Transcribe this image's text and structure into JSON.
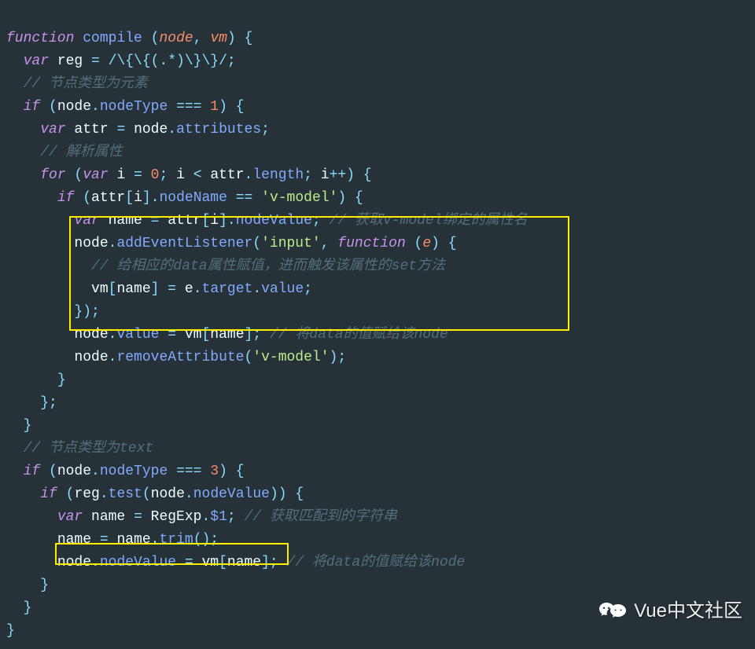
{
  "code": {
    "l1_kw_function": "function",
    "l1_fn": "compile",
    "l1_paren_open": "(",
    "l1_param1": "node",
    "l1_comma": ", ",
    "l1_param2": "vm",
    "l1_paren_close": ")",
    "l1_brace": " {",
    "l2_kw_var": "var",
    "l2_name": " reg ",
    "l2_eq": "=",
    "l2_regex": " /\\{\\{(.*)\\}\\}/",
    "l2_semi": ";",
    "l3_comment": "// 节点类型为元素",
    "l4_kw_if": "if",
    "l4_open": " (",
    "l4_node": "node",
    "l4_dot": ".",
    "l4_prop": "nodeType",
    "l4_eqeq": " === ",
    "l4_num": "1",
    "l4_close": ") {",
    "l5_kw_var": "var",
    "l5_name": " attr ",
    "l5_eq": "=",
    "l5_sp": " ",
    "l5_node": "node",
    "l5_dot": ".",
    "l5_prop": "attributes",
    "l5_semi": ";",
    "l6_comment": "// 解析属性",
    "l7_kw_for": "for",
    "l7_open": " (",
    "l7_kw_var": "var",
    "l7_i": " i ",
    "l7_eq": "=",
    "l7_sp": " ",
    "l7_zero": "0",
    "l7_semi1": "; ",
    "l7_i2": "i ",
    "l7_lt": "<",
    "l7_sp2": " ",
    "l7_attr": "attr",
    "l7_dot": ".",
    "l7_len": "length",
    "l7_semi2": "; ",
    "l7_i3": "i",
    "l7_pp": "++",
    "l7_close": ") {",
    "l8_kw_if": "if",
    "l8_open": " (",
    "l8_attr": "attr",
    "l8_br1": "[",
    "l8_i": "i",
    "l8_br2": "]",
    "l8_dot": ".",
    "l8_nn": "nodeName",
    "l8_eqeq": " == ",
    "l8_str": "'v-model'",
    "l8_close": ") {",
    "l9_kw_var": "var",
    "l9_name": " name ",
    "l9_eq": "=",
    "l9_sp": " ",
    "l9_attr": "attr",
    "l9_br1": "[",
    "l9_i": "i",
    "l9_br2": "]",
    "l9_dot": ".",
    "l9_nv": "nodeValue",
    "l9_semi": "; ",
    "l9_comment": "// 获取v-model绑定的属性名",
    "l10_node": "node",
    "l10_dot": ".",
    "l10_fn": "addEventListener",
    "l10_open": "(",
    "l10_str": "'input'",
    "l10_comma": ", ",
    "l10_kw_fn": "function",
    "l10_po": " (",
    "l10_e": "e",
    "l10_pc": ") {",
    "l11_comment": "// 给相应的data属性赋值，进而触发该属性的set方法",
    "l12_vm": "vm",
    "l12_br1": "[",
    "l12_name": "name",
    "l12_br2": "]",
    "l12_eq": " = ",
    "l12_e": "e",
    "l12_dot": ".",
    "l12_tgt": "target",
    "l12_dot2": ".",
    "l12_val": "value",
    "l12_semi": ";",
    "l13_close": "});",
    "l14_node": "node",
    "l14_dot": ".",
    "l14_val": "value",
    "l14_eq": " = ",
    "l14_vm": "vm",
    "l14_br1": "[",
    "l14_name": "name",
    "l14_br2": "]",
    "l14_semi": "; ",
    "l14_comment": "// 将data的值赋给该node",
    "l15_node": "node",
    "l15_dot": ".",
    "l15_fn": "removeAttribute",
    "l15_open": "(",
    "l15_str": "'v-model'",
    "l15_close": ");",
    "l16_brace": "}",
    "l17_brace": "};",
    "l18_brace": "}",
    "l19_comment": "// 节点类型为text",
    "l20_kw_if": "if",
    "l20_open": " (",
    "l20_node": "node",
    "l20_dot": ".",
    "l20_prop": "nodeType",
    "l20_eqeq": " === ",
    "l20_num": "3",
    "l20_close": ") {",
    "l21_kw_if": "if",
    "l21_open": " (",
    "l21_reg": "reg",
    "l21_dot": ".",
    "l21_fn": "test",
    "l21_po": "(",
    "l21_node": "node",
    "l21_dot2": ".",
    "l21_nv": "nodeValue",
    "l21_close": ")) {",
    "l22_kw_var": "var",
    "l22_name": " name ",
    "l22_eq": "=",
    "l22_sp": " ",
    "l22_re": "RegExp",
    "l22_dot": ".",
    "l22_d1": "$1",
    "l22_semi": "; ",
    "l22_comment": "// 获取匹配到的字符串",
    "l23_name": "name ",
    "l23_eq": "=",
    "l23_sp": " ",
    "l23_name2": "name",
    "l23_dot": ".",
    "l23_fn": "trim",
    "l23_call": "();",
    "l24_node": "node",
    "l24_dot": ".",
    "l24_nv": "nodeValue",
    "l24_eq": " = ",
    "l24_vm": "vm",
    "l24_br1": "[",
    "l24_name": "name",
    "l24_br2": "]",
    "l24_semi": "; ",
    "l24_comment": "// 将data的值赋给该node",
    "l25_brace": "}",
    "l26_brace": "}",
    "l27_brace": "}"
  },
  "watermark": "Vue中文社区"
}
